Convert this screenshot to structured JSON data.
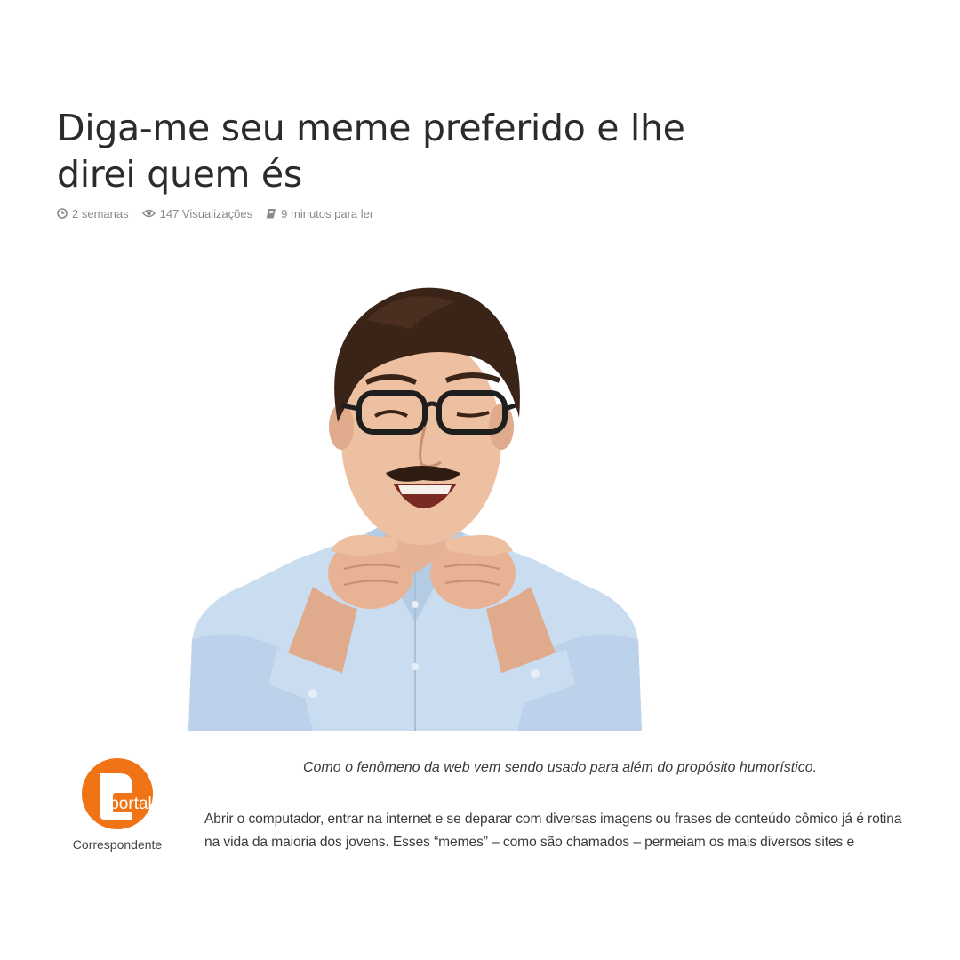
{
  "article": {
    "title": "Diga-me seu meme preferido e lhe direi quem és",
    "subtitle": "Como o fenômeno da web vem sendo usado para além do propósito humorístico.",
    "body": "Abrir o computador, entrar na internet e se deparar com diversas imagens ou frases de conteúdo cômico já é rotina na vida da maioria dos jovens. Esses “memes” – como são chamados – permeiam os mais diversos sites e"
  },
  "meta": {
    "time": "2 semanas",
    "views": "147 Visualizações",
    "read_time": "9 minutos para ler",
    "icons": [
      "clock-icon",
      "eye-icon",
      "book-icon"
    ]
  },
  "author": {
    "logo_text": "portal",
    "role": "Correspondente",
    "logo_color": "#f07315"
  },
  "colors": {
    "title": "#2b2b2b",
    "meta": "#8a8a8a",
    "accent": "#f07315",
    "shirt": "#c9dcf0"
  }
}
